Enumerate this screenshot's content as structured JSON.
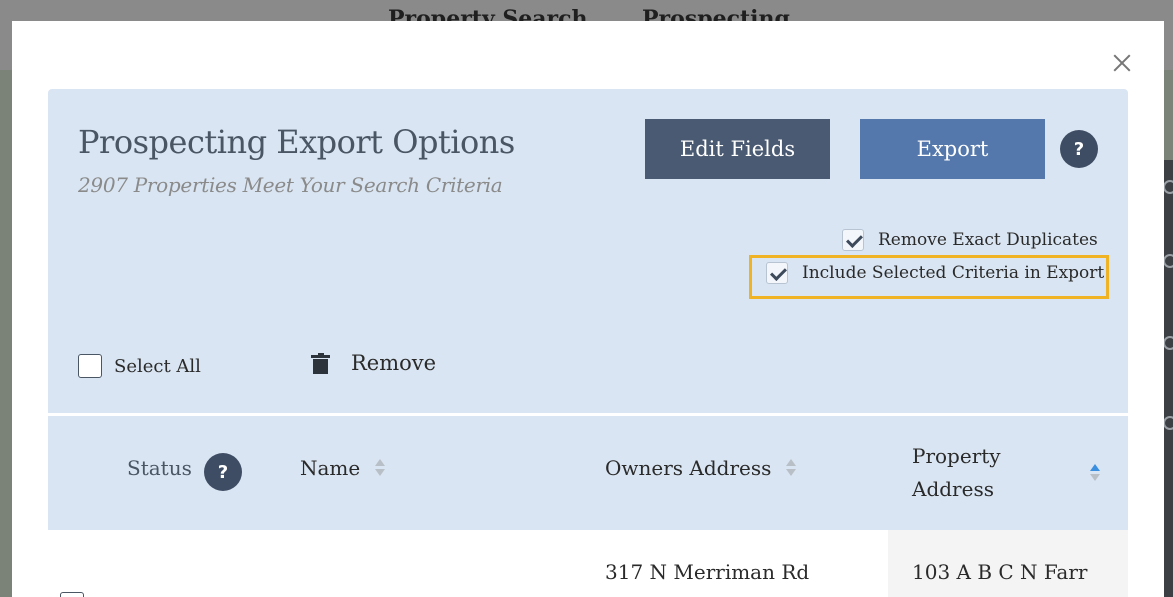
{
  "background": {
    "nav_items": [
      "Property Search",
      "Prospecting"
    ]
  },
  "modal": {
    "title": "Prospecting Export Options",
    "subtitle": "2907 Properties Meet Your Search Criteria",
    "buttons": {
      "edit_fields": "Edit Fields",
      "export": "Export",
      "help": "?"
    },
    "options": {
      "remove_duplicates": {
        "label": "Remove Exact Duplicates",
        "checked": true
      },
      "include_criteria": {
        "label": "Include Selected Criteria in Export",
        "checked": true
      }
    },
    "toolbar": {
      "select_all": "Select All",
      "remove": "Remove"
    },
    "table": {
      "columns": {
        "status": "Status",
        "status_help": "?",
        "name": "Name",
        "owners_address": "Owners Address",
        "property_address": "Property Address"
      },
      "sorted_column": "property_address",
      "rows": [
        {
          "owners_address": "317 N Merriman Rd",
          "property_address": "103 A B C N Farr"
        }
      ]
    }
  },
  "colors": {
    "highlight_border": "#f0b323",
    "primary_button": "#5478ab",
    "secondary_button": "#4a5a72",
    "panel_bg": "#d9e5f2"
  }
}
